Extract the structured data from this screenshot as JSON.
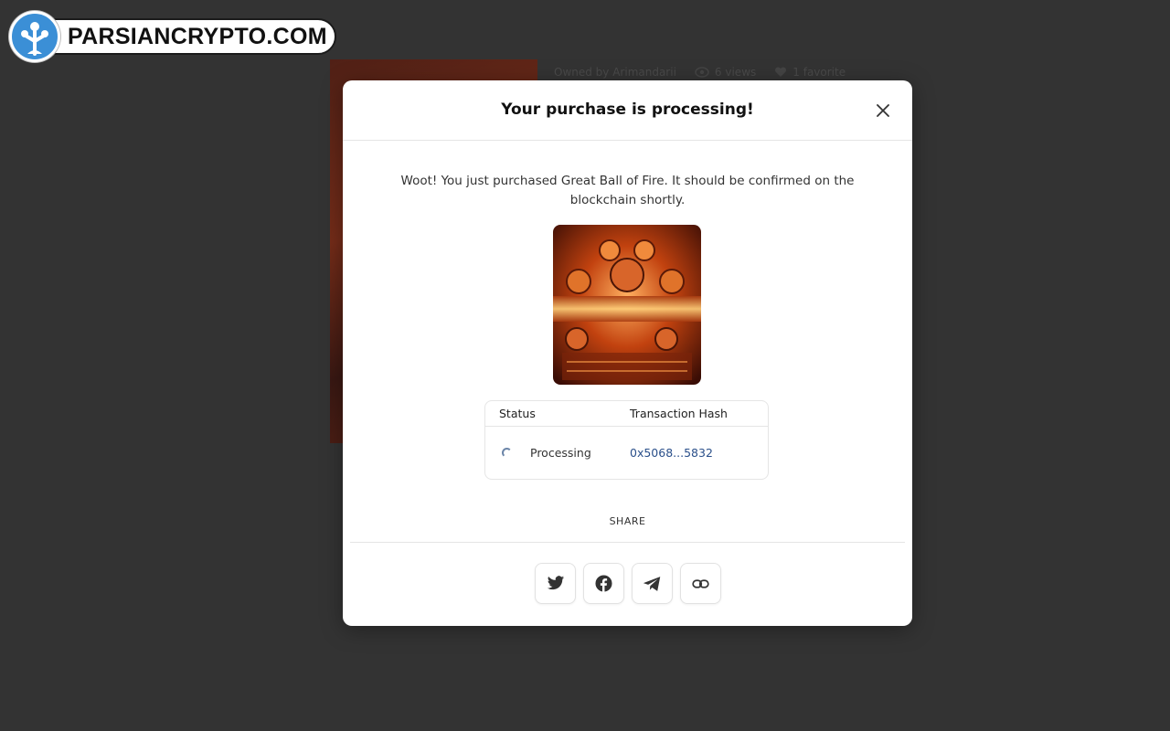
{
  "watermark": {
    "text": "PARSIANCRYPTO.COM"
  },
  "background": {
    "owned_by": "Owned by Arimandarii",
    "views": "6 views",
    "favorites": "1 favorite"
  },
  "modal": {
    "title": "Your purchase is processing!",
    "message": "Woot! You just purchased Great Ball of Fire. It should be confirmed on the blockchain shortly.",
    "table": {
      "headers": {
        "status": "Status",
        "hash": "Transaction Hash"
      },
      "row": {
        "status": "Processing",
        "hash": "0x5068...5832"
      }
    },
    "share_label": "SHARE",
    "share_buttons": [
      {
        "icon": "twitter-icon"
      },
      {
        "icon": "facebook-icon"
      },
      {
        "icon": "telegram-icon"
      },
      {
        "icon": "link-icon"
      }
    ]
  }
}
